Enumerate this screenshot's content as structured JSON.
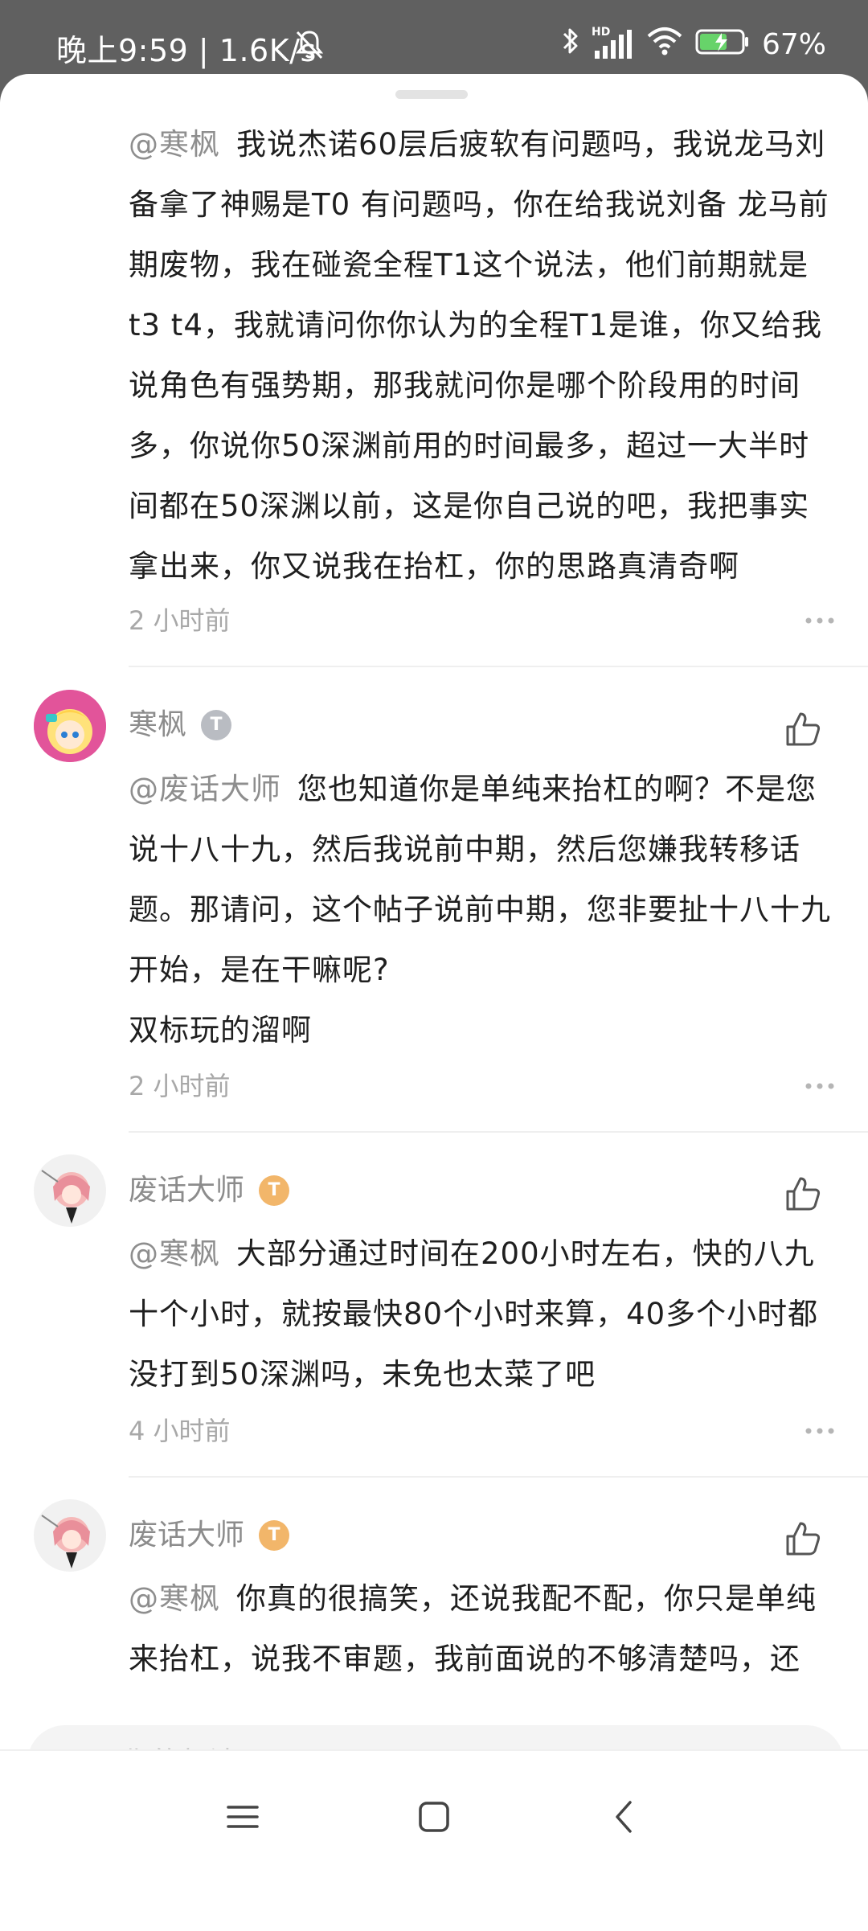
{
  "status_bar": {
    "time_speed": "晚上9:59 | 1.6K/s",
    "network_label": "HD",
    "battery": "67%"
  },
  "comments": [
    {
      "mention": "@寒枫",
      "text": "我说杰诺60层后疲软有问题吗，我说龙马刘备拿了神赐是T0 有问题吗，你在给我说刘备 龙马前期废物，我在碰瓷全程T1这个说法，他们前期就是t3 t4，我就请问你你认为的全程T1是谁，你又给我说角色有强势期，那我就问你是哪个阶段用的时间多，你说你50深渊前用的时间最多，超过一大半时间都在50深渊以前，这是你自己说的吧，我把事实拿出来，你又说我在抬杠，你的思路真清奇啊",
      "time": "2 小时前"
    },
    {
      "username": "寒枫",
      "badge": "T",
      "mention": "@废话大师",
      "text": "您也知道你是单纯来抬杠的啊？不是您说十八十九，然后我说前中期，然后您嫌我转移话题。那请问，这个帖子说前中期，您非要扯十八十九开始，是在干嘛呢?",
      "text2": "双标玩的溜啊",
      "time": "2 小时前"
    },
    {
      "username": "废话大师",
      "badge": "T",
      "mention": "@寒枫",
      "text": "大部分通过时间在200小时左右，快的八九十个小时，就按最快80个小时来算，40多个小时都没打到50深渊吗，未免也太菜了吧",
      "time": "4 小时前"
    },
    {
      "username": "废话大师",
      "badge": "T",
      "mention": "@寒枫",
      "text": "你真的很搞笑，还说我配不配，你只是单纯来抬杠，说我不审题，我前面说的不够清楚吗，还"
    }
  ],
  "input": {
    "placeholder": "写下你的想法..."
  },
  "icons": {
    "like": "thumbs-up-icon",
    "more": "more-dots-icon",
    "nav_menu": "menu-icon",
    "nav_home": "home-square-icon",
    "nav_back": "back-chevron-icon"
  },
  "colors": {
    "status_bar_bg": "#606060",
    "badge_gray": "#b9bcc2",
    "badge_gold": "#f2b66a",
    "mention": "#8e8e8e"
  }
}
